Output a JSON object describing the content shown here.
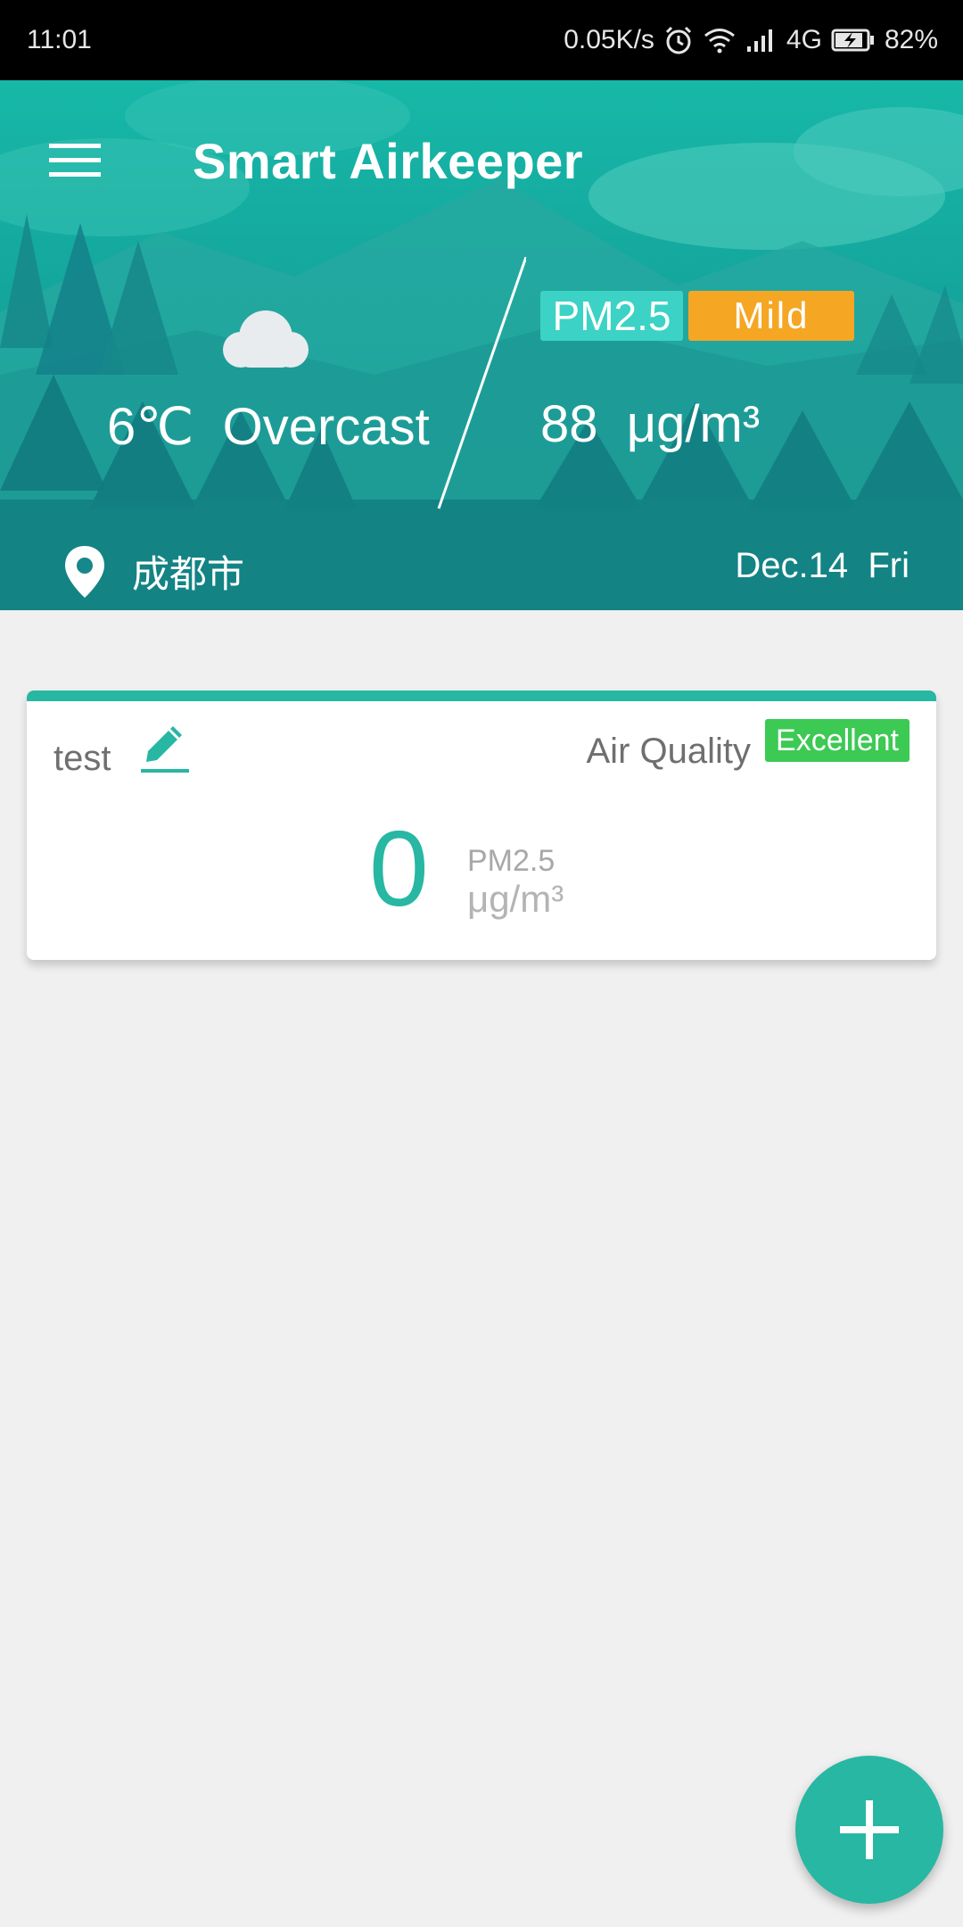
{
  "status_bar": {
    "time": "11:01",
    "network_speed": "0.05K/s",
    "network_type": "4G",
    "battery": "82%",
    "icons": [
      "alarm-icon",
      "wifi-icon",
      "signal-icon",
      "battery-charging-icon"
    ]
  },
  "header": {
    "title": "Smart Airkeeper",
    "menu_icon": "hamburger-menu-icon",
    "weather": {
      "icon": "cloud-icon",
      "text": "6℃  Overcast"
    },
    "pm": {
      "tag": "PM2.5",
      "level": "Mild",
      "value": "88  μg/m³"
    },
    "location": {
      "icon": "location-pin-icon",
      "label": "成都市"
    },
    "date": "Dec.14  Fri"
  },
  "devices": [
    {
      "name": "test",
      "edit_icon": "pencil-edit-icon",
      "air_quality_label": "Air Quality",
      "quality_badge": "Excellent",
      "value": "0",
      "metric": "PM2.5",
      "unit": "μg/m³"
    }
  ],
  "fab": {
    "icon": "plus-icon"
  },
  "colors": {
    "accent": "#27b7a3",
    "header_teal": "#17b8a8",
    "mild": "#f5a623",
    "excellent": "#3cc954",
    "pm_tag": "#3cd2c6"
  }
}
